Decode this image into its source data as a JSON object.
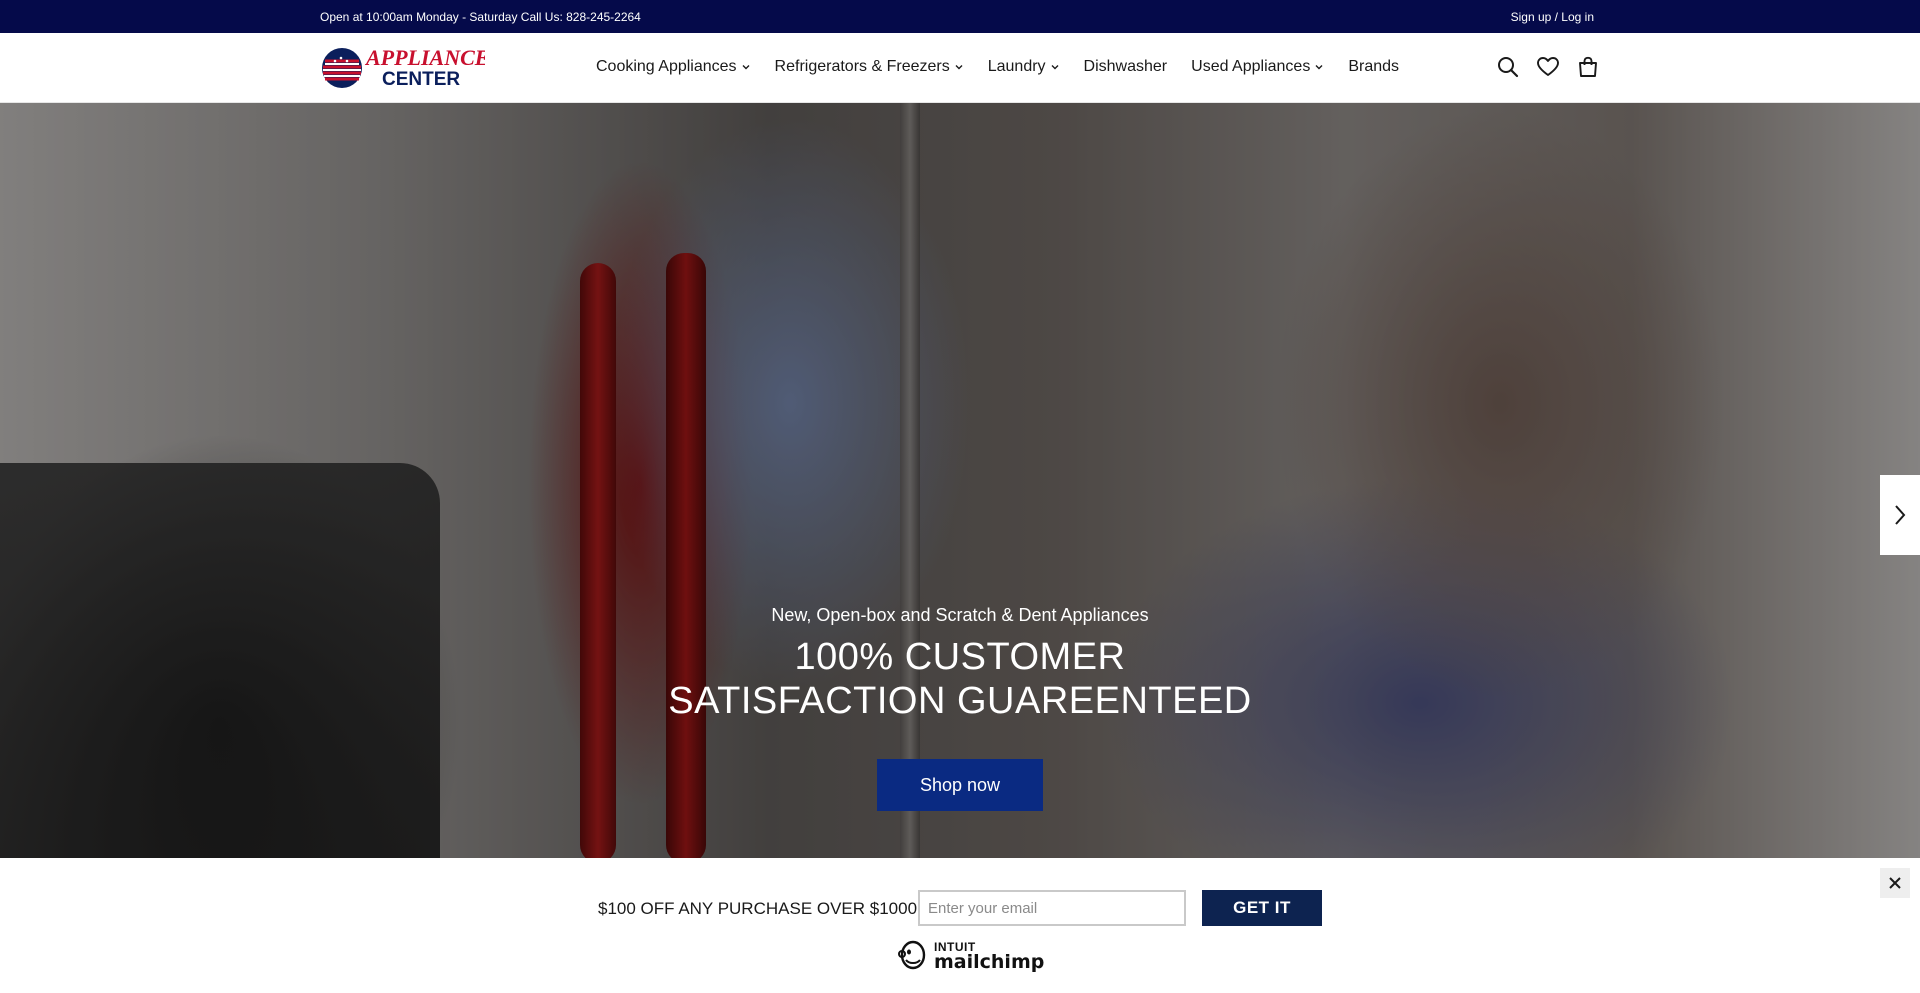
{
  "topbar": {
    "hours": "Open at 10:00am Monday - Saturday Call Us: 828-245-2264",
    "account_link": "Sign up / Log in"
  },
  "header": {
    "logo_text_top": "APPLIANCE",
    "logo_text_bottom": "CENTER",
    "nav": [
      {
        "label": "Cooking Appliances",
        "has_dropdown": true
      },
      {
        "label": "Refrigerators & Freezers",
        "has_dropdown": true
      },
      {
        "label": "Laundry",
        "has_dropdown": true
      },
      {
        "label": "Dishwasher",
        "has_dropdown": false
      },
      {
        "label": "Used Appliances",
        "has_dropdown": true
      },
      {
        "label": "Brands",
        "has_dropdown": false
      }
    ],
    "icons": [
      "search-icon",
      "heart-icon",
      "bag-icon"
    ]
  },
  "hero": {
    "subtitle": "New, Open-box and Scratch & Dent Appliances",
    "title": "100% CUSTOMER SATISFACTION GUAREENTEED",
    "button_label": "Shop now"
  },
  "popup": {
    "offer_text": "$100 OFF ANY PURCHASE OVER $1000!",
    "email_placeholder": "Enter your email",
    "button_label": "GET IT",
    "brand_line1": "INTUIT",
    "brand_line2": "mailchimp"
  },
  "colors": {
    "topbar_bg": "#050a4a",
    "accent_button": "#0a2a82",
    "popup_button": "#0d2350",
    "logo_red": "#c8102e",
    "logo_navy": "#0b1f5c"
  }
}
